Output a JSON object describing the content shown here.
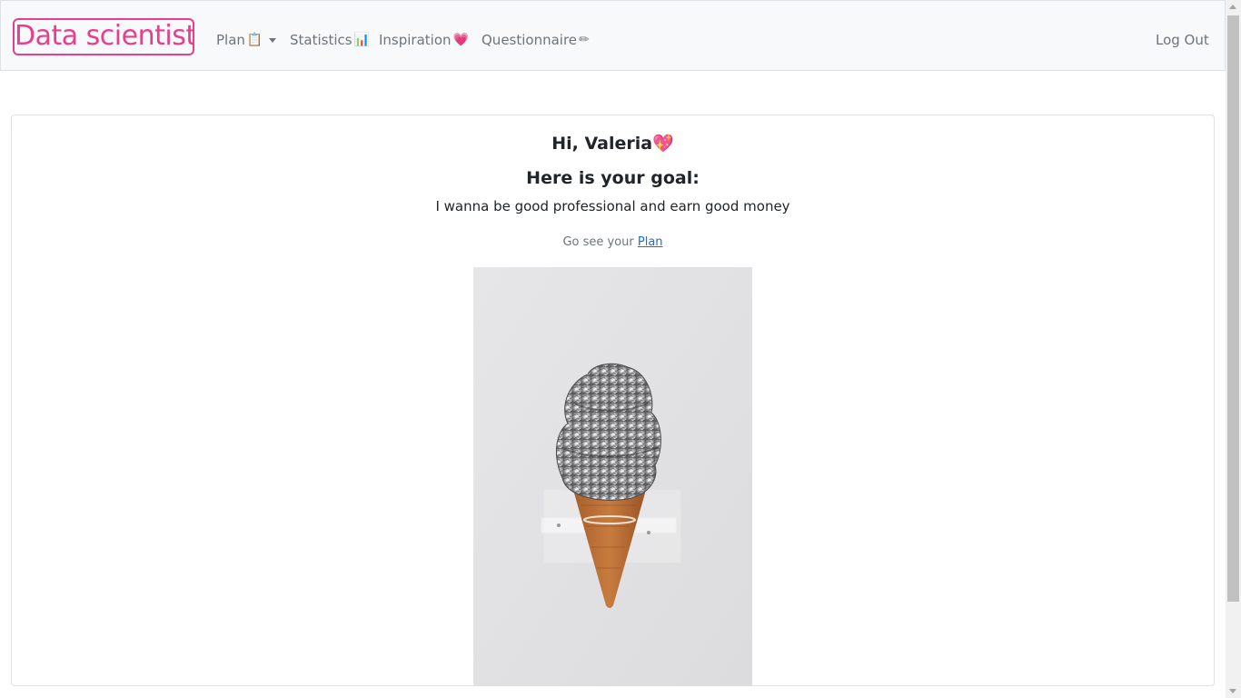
{
  "navbar": {
    "brand": "Data scientist",
    "items": [
      {
        "label": "Plan",
        "icon": "clipboard-icon",
        "glyph": "📋",
        "dropdown": true
      },
      {
        "label": "Statistics",
        "icon": "bar-chart-icon",
        "glyph": "📊"
      },
      {
        "label": "Inspiration",
        "icon": "heart-icon",
        "glyph": "💗"
      },
      {
        "label": "Questionnaire",
        "icon": "pencil-icon",
        "glyph": "✏"
      }
    ],
    "logout": "Log Out"
  },
  "main": {
    "greeting": "Hi, Valeria",
    "greeting_glyph": "💖",
    "goal_title": "Here is your goal:",
    "goal_text": "I wanna be good professional and earn good money",
    "plan_prefix": "Go see your",
    "plan_link": "Plan",
    "image_icon": "ice-cream-cone-foil-image"
  },
  "colors": {
    "brand": "#e83e8c",
    "navbar_bg": "#f8f9fa",
    "link": "#0d6efd",
    "muted": "#6c757d"
  }
}
